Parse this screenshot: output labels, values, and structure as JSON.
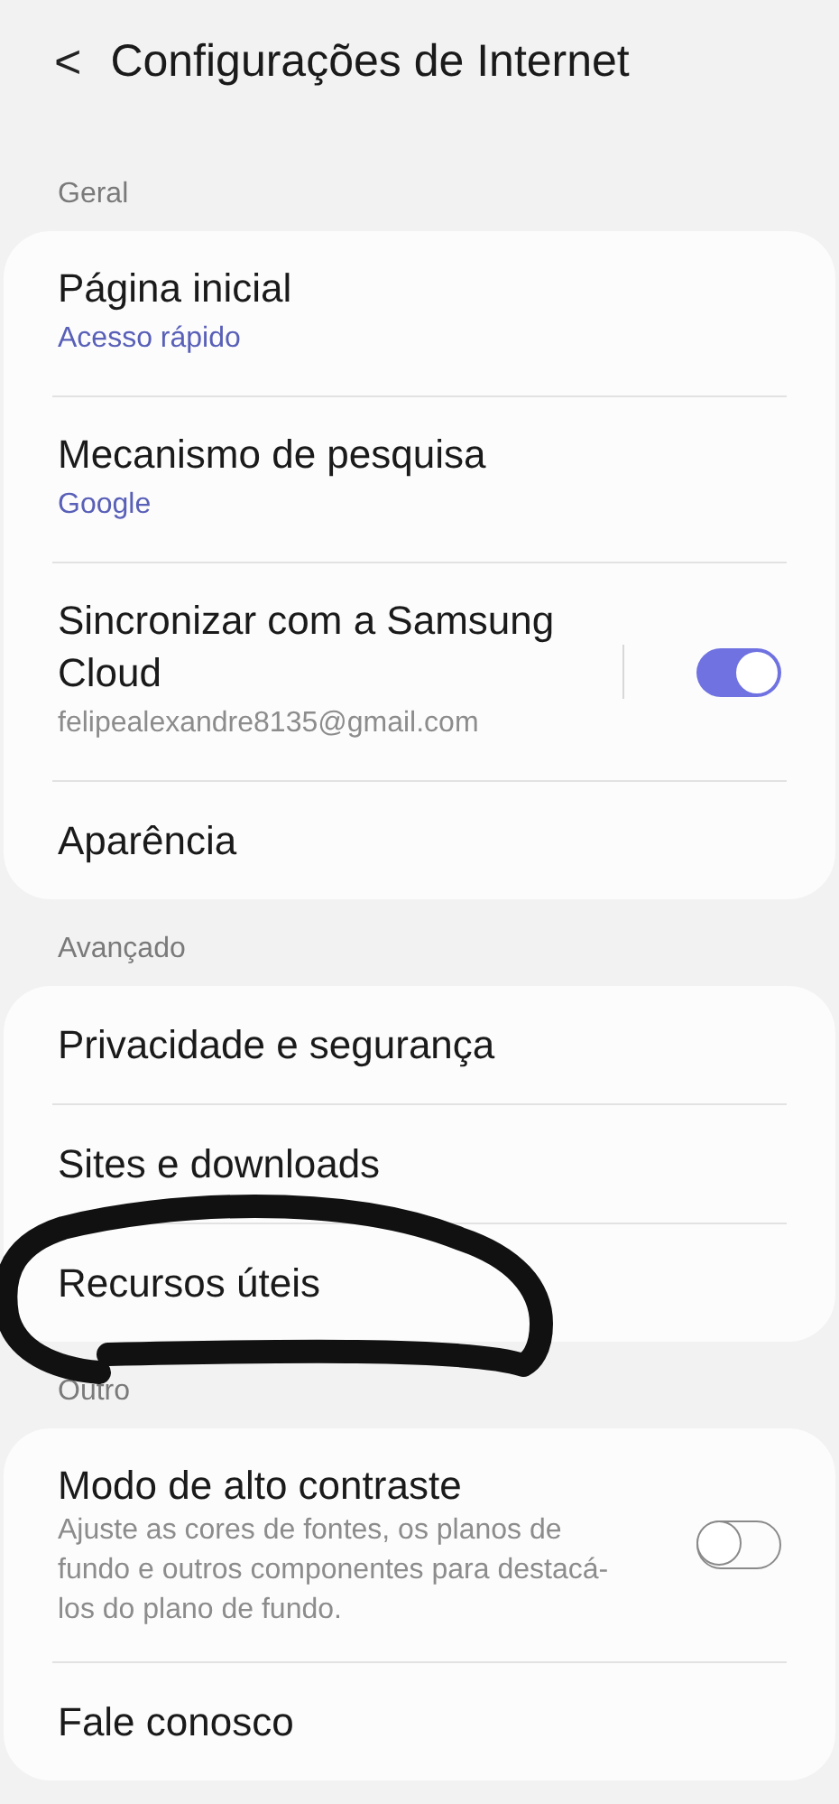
{
  "header": {
    "back": "<",
    "title": "Configurações de Internet"
  },
  "sections": [
    {
      "label": "Geral",
      "rows": [
        {
          "kind": "nav",
          "title": "Página inicial",
          "subtitle": "Acesso rápido",
          "accent": true
        },
        {
          "kind": "nav",
          "title": "Mecanismo de pesquisa",
          "subtitle": "Google",
          "accent": true
        },
        {
          "kind": "toggle",
          "title": "Sincronizar com a Samsung Cloud",
          "subtitle": "felipealexandre8135@gmail.com",
          "accent": false,
          "on": true
        },
        {
          "kind": "nav",
          "title": "Aparência"
        }
      ]
    },
    {
      "label": "Avançado",
      "rows": [
        {
          "kind": "nav",
          "title": "Privacidade e segurança"
        },
        {
          "kind": "nav",
          "title": "Sites e downloads"
        },
        {
          "kind": "nav",
          "title": "Recursos úteis"
        }
      ]
    },
    {
      "label": "Outro",
      "rows": [
        {
          "kind": "toggle",
          "title": "Modo de alto contraste",
          "subtitle": "Ajuste as cores de fontes, os planos de fundo e outros componentes para destacá-los do plano de fundo.",
          "accent": false,
          "on": false
        },
        {
          "kind": "nav",
          "title": "Fale conosco"
        }
      ]
    }
  ]
}
